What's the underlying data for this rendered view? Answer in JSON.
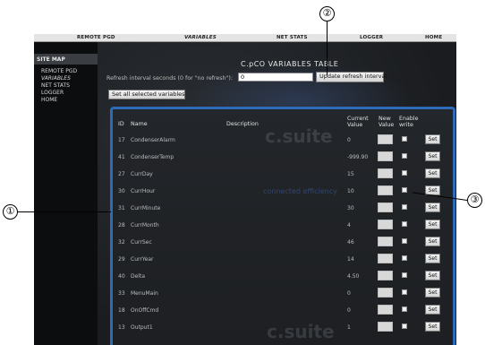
{
  "topnav": {
    "items": [
      {
        "label": "REMOTE PGD",
        "active": false
      },
      {
        "label": "VARIABLES",
        "active": true
      },
      {
        "label": "NET STATS",
        "active": false
      },
      {
        "label": "LOGGER",
        "active": false
      },
      {
        "label": "HOME",
        "active": false
      }
    ]
  },
  "sidebar": {
    "heading": "SITE MAP",
    "items": [
      {
        "label": "REMOTE PGD",
        "active": false
      },
      {
        "label": "VARIABLES",
        "active": true
      },
      {
        "label": "NET STATS",
        "active": false
      },
      {
        "label": "LOGGER",
        "active": false
      },
      {
        "label": "HOME",
        "active": false
      }
    ]
  },
  "main": {
    "title": "C.pCO VARIABLES TABLE",
    "refresh_label": "Refresh interval seconds (0 for \"no refresh\"):",
    "refresh_value": "0",
    "update_button": "Update refresh interval",
    "set_selected_button": "Set all selected variables",
    "watermark": "c.suite",
    "tagline": "connected efficiency",
    "columns": {
      "id": "ID",
      "name": "Name",
      "description": "Description",
      "current_value": [
        "Current",
        "Value"
      ],
      "new_value": [
        "New",
        "Value"
      ],
      "enable_write": [
        "Enable",
        "write"
      ]
    },
    "set_label": "Set",
    "rows": [
      {
        "id": "17",
        "name": "CondenserAlarm",
        "value": "0"
      },
      {
        "id": "41",
        "name": "CondenserTemp",
        "value": "-999.90"
      },
      {
        "id": "27",
        "name": "CurrDay",
        "value": "15"
      },
      {
        "id": "30",
        "name": "CurrHour",
        "value": "10"
      },
      {
        "id": "31",
        "name": "CurrMinute",
        "value": "30"
      },
      {
        "id": "28",
        "name": "CurrMonth",
        "value": "4"
      },
      {
        "id": "32",
        "name": "CurrSec",
        "value": "46"
      },
      {
        "id": "29",
        "name": "CurrYear",
        "value": "14"
      },
      {
        "id": "40",
        "name": "Delta",
        "value": "4.50"
      },
      {
        "id": "33",
        "name": "MenuMain",
        "value": "0"
      },
      {
        "id": "18",
        "name": "OnOffCmd",
        "value": "0"
      },
      {
        "id": "13",
        "name": "Output1",
        "value": "1"
      }
    ]
  },
  "callouts": [
    "①",
    "②",
    "③"
  ]
}
